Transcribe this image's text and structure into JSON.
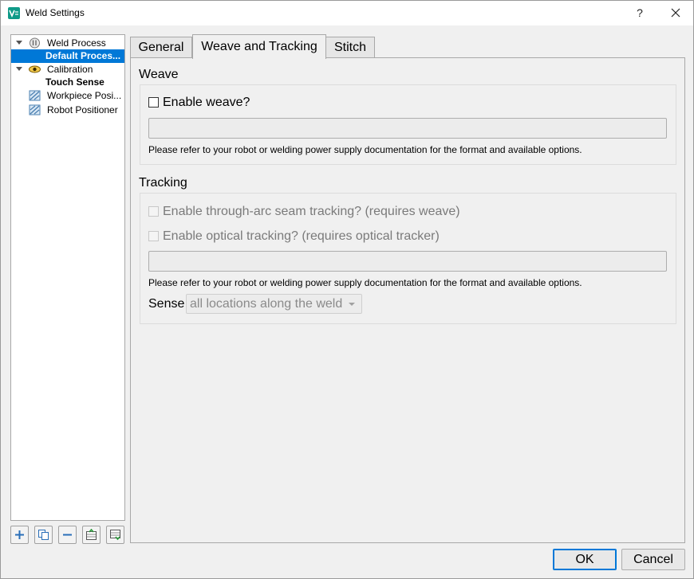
{
  "window": {
    "title": "Weld Settings",
    "help_glyph": "?",
    "accent": "#0078d7"
  },
  "tree": {
    "items": [
      {
        "label": "Weld Process",
        "icon": "weld-process-icon",
        "expanded": true
      },
      {
        "label": "Default Proces...",
        "selected": true
      },
      {
        "label": "Calibration",
        "icon": "eye-icon",
        "expanded": true
      },
      {
        "label": "Touch Sense",
        "bold": true
      },
      {
        "label": "Workpiece Posi...",
        "icon": "positioner-icon"
      },
      {
        "label": "Robot Positioner",
        "icon": "positioner-icon"
      }
    ]
  },
  "toolbar": [
    "add-icon",
    "copy-icon",
    "remove-icon",
    "import-icon",
    "export-icon"
  ],
  "tabs": [
    {
      "label": "General"
    },
    {
      "label": "Weave and Tracking",
      "active": true
    },
    {
      "label": "Stitch"
    }
  ],
  "weave": {
    "title": "Weave",
    "enable_label": "Enable weave?",
    "enabled": false,
    "field_value": "",
    "hint": "Please refer to your robot or welding power supply documentation for the format and available options."
  },
  "tracking": {
    "title": "Tracking",
    "through_arc_label": "Enable through-arc seam tracking? (requires weave)",
    "optical_label": "Enable optical tracking? (requires optical tracker)",
    "field_value": "",
    "hint": "Please refer to your robot or welding power supply documentation for the format and available options.",
    "sense_label": "Sense",
    "sense_value": "all locations along the weld"
  },
  "buttons": {
    "ok": "OK",
    "cancel": "Cancel"
  }
}
